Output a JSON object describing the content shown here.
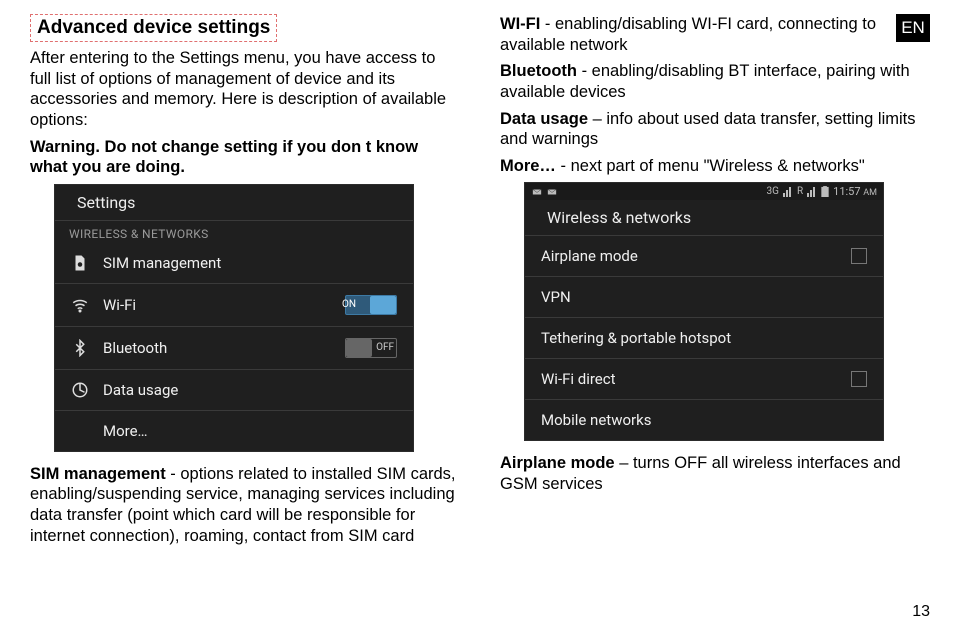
{
  "lang_tag": "EN",
  "page_number": "13",
  "left": {
    "heading": "Advanced device settings",
    "p1": "After entering to the Settings menu, you have access to full list of options of management of device and its accessories and memory. Here is description of available options:",
    "p2_bold": "Warning. Do not change setting if you don t know what you are doing.",
    "sim_bold": "SIM management",
    "sim_rest": " - options related to installed SIM cards, enabling/suspending service, managing services including data transfer (point which card will be responsible for internet connection), roaming, contact from SIM card"
  },
  "right": {
    "wifi_bold": "WI-FI",
    "wifi_rest": " - enabling/disabling WI-FI card, connecting to available network",
    "bt_bold": "Bluetooth",
    "bt_rest": " - enabling/disabling BT interface, pairing with available devices",
    "du_bold": "Data usage",
    "du_rest": " – info about used data transfer, setting limits and warnings",
    "more_bold": "More…",
    "more_rest": " - next part of menu \"Wireless & networks\"",
    "air_bold": "Airplane mode",
    "air_rest": " – turns OFF all wireless interfaces and GSM services"
  },
  "phone1": {
    "title": "Settings",
    "section": "WIRELESS & NETWORKS",
    "items": {
      "sim": "SIM management",
      "wifi": "Wi-Fi",
      "wifi_toggle": "ON",
      "bt": "Bluetooth",
      "bt_toggle": "OFF",
      "data": "Data usage",
      "more": "More…"
    }
  },
  "phone2": {
    "time": "11:57 ",
    "time_ampm": "AM",
    "title": "Wireless & networks",
    "items": {
      "airplane": "Airplane mode",
      "vpn": "VPN",
      "tether": "Tethering & portable hotspot",
      "wifidirect": "Wi-Fi direct",
      "mobile": "Mobile networks"
    }
  }
}
